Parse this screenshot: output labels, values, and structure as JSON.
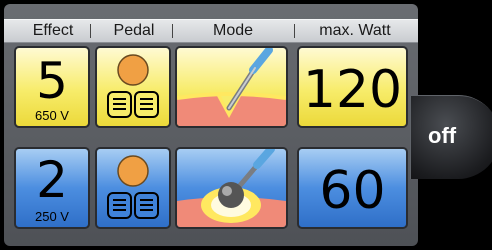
{
  "header": {
    "effect": "Effect",
    "pedal": "Pedal",
    "mode": "Mode",
    "max_watt": "max. Watt"
  },
  "rows": [
    {
      "effect_level": "5",
      "voltage": "650 V",
      "max_watt": "120",
      "color": "#f2e44c"
    },
    {
      "effect_level": "2",
      "voltage": "250 V",
      "max_watt": "60",
      "color": "#3f82d9"
    }
  ],
  "off_button": {
    "label": "off"
  },
  "colors": {
    "pedal_orange": "#f0a044",
    "tissue_pink": "#f08a78",
    "tissue_yellow": "#ffe860"
  },
  "icons": {
    "pedal": "foot-pedal-icon",
    "cut_mode": "electrode-blade-cut-icon",
    "coag_mode": "ball-electrode-coag-icon"
  }
}
